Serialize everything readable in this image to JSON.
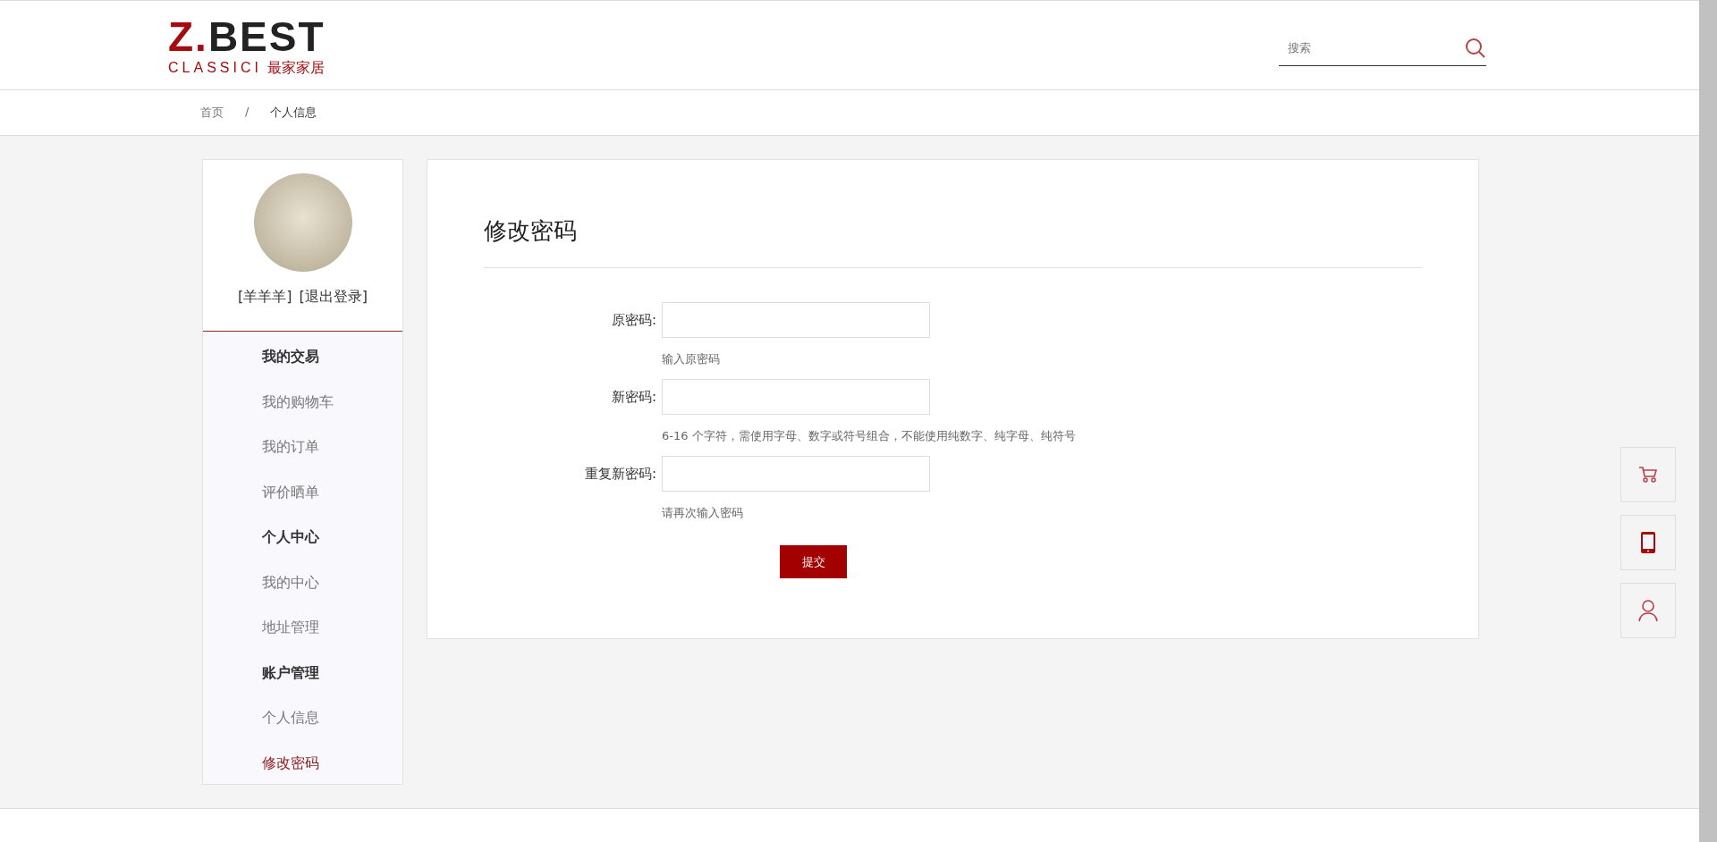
{
  "header": {
    "logo": {
      "title": "Z.BEST",
      "subtitle_latin": "CLASSICI",
      "subtitle_cn": "最家家居"
    },
    "search": {
      "placeholder": "搜索"
    }
  },
  "breadcrumb": {
    "items": [
      "首页",
      "个人信息"
    ],
    "separator": "/"
  },
  "sidebar": {
    "user": {
      "name": "[羊羊羊]",
      "logout": "[退出登录]"
    },
    "sections": [
      {
        "title": "我的交易",
        "items": [
          {
            "label": "我的购物车",
            "selected": false
          },
          {
            "label": "我的订单",
            "selected": false
          },
          {
            "label": "评价晒单",
            "selected": false
          }
        ]
      },
      {
        "title": "个人中心",
        "items": [
          {
            "label": "我的中心",
            "selected": false
          },
          {
            "label": "地址管理",
            "selected": false
          }
        ]
      },
      {
        "title": "账户管理",
        "items": [
          {
            "label": "个人信息",
            "selected": false
          },
          {
            "label": "修改密码",
            "selected": true
          }
        ]
      }
    ]
  },
  "form": {
    "title": "修改密码",
    "fields": [
      {
        "label": "原密码:",
        "hint": "输入原密码"
      },
      {
        "label": "新密码:",
        "hint": "6-16 个字符，需使用字母、数字或符号组合，不能使用纯数字、纯字母、纯符号"
      },
      {
        "label": "重复新密码:",
        "hint": "请再次输入密码"
      }
    ],
    "submit": "提交"
  },
  "float_tools": [
    {
      "kind": "cart"
    },
    {
      "kind": "phone"
    },
    {
      "kind": "user"
    }
  ]
}
